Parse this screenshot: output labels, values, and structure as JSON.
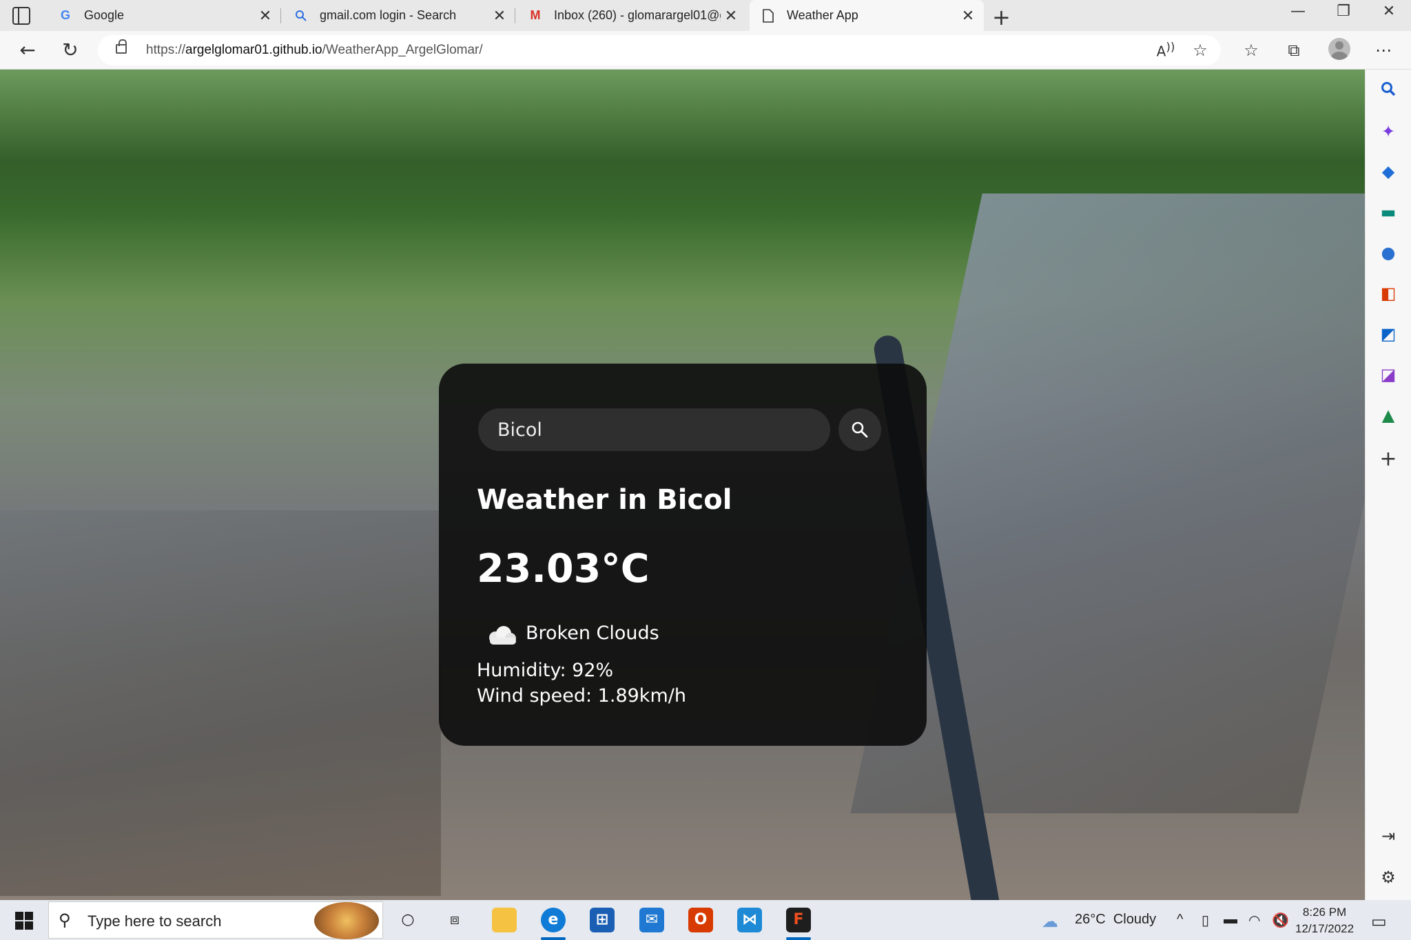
{
  "browser": {
    "tabs": [
      {
        "title": "Google",
        "favicon": "google-icon"
      },
      {
        "title": "gmail.com login - Search",
        "favicon": "search-icon"
      },
      {
        "title": "Inbox (260) - glomarargel01@gm",
        "favicon": "gmail-icon"
      },
      {
        "title": "Weather App",
        "favicon": "page-icon",
        "active": true
      }
    ],
    "url_prefix": "https://",
    "url_host": "argelglomar01.github.io",
    "url_path": "/WeatherApp_ArgelGlomar/"
  },
  "weather": {
    "search_value": "Bicol",
    "city_heading": "Weather in Bicol",
    "temperature": "23.03°C",
    "icon": "cloud-icon",
    "description": "Broken Clouds",
    "humidity": "Humidity: 92%",
    "wind": "Wind speed: 1.89km/h"
  },
  "taskbar": {
    "search_placeholder": "Type here to search",
    "weather_temp": "26°C",
    "weather_desc": "Cloudy",
    "time": "8:26 PM",
    "date": "12/17/2022"
  }
}
